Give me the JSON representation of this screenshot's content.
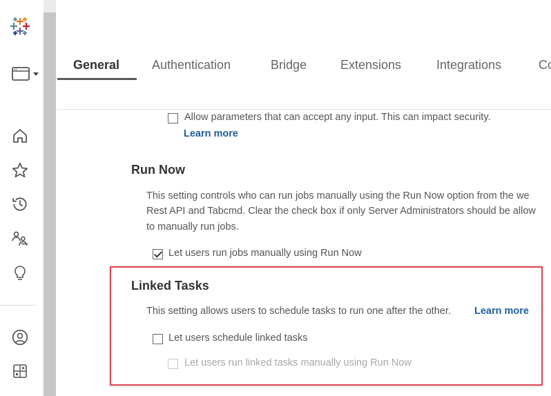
{
  "tabs": [
    "General",
    "Authentication",
    "Bridge",
    "Extensions",
    "Integrations",
    "Co"
  ],
  "params": {
    "checkbox_label": "Allow parameters that can accept any input. This can impact security.",
    "learn_more": "Learn more"
  },
  "run_now": {
    "title": "Run Now",
    "desc_line1": "This setting controls who can run jobs manually using the Run Now option from the we",
    "desc_line2": "Rest API and Tabcmd. Clear the check box if only Server Administrators should be allow",
    "desc_line3": "to manually run jobs.",
    "checkbox_label": "Let users run jobs manually using Run Now"
  },
  "linked_tasks": {
    "title": "Linked Tasks",
    "desc": "This setting allows users to schedule tasks to run one after the other.",
    "learn_more": "Learn more",
    "checkbox_label": "Let users schedule linked tasks",
    "sub_checkbox_label": "Let users run linked tasks manually using Run Now"
  },
  "colors": {
    "highlight": "#e0454e",
    "link": "#1f5f9e"
  }
}
